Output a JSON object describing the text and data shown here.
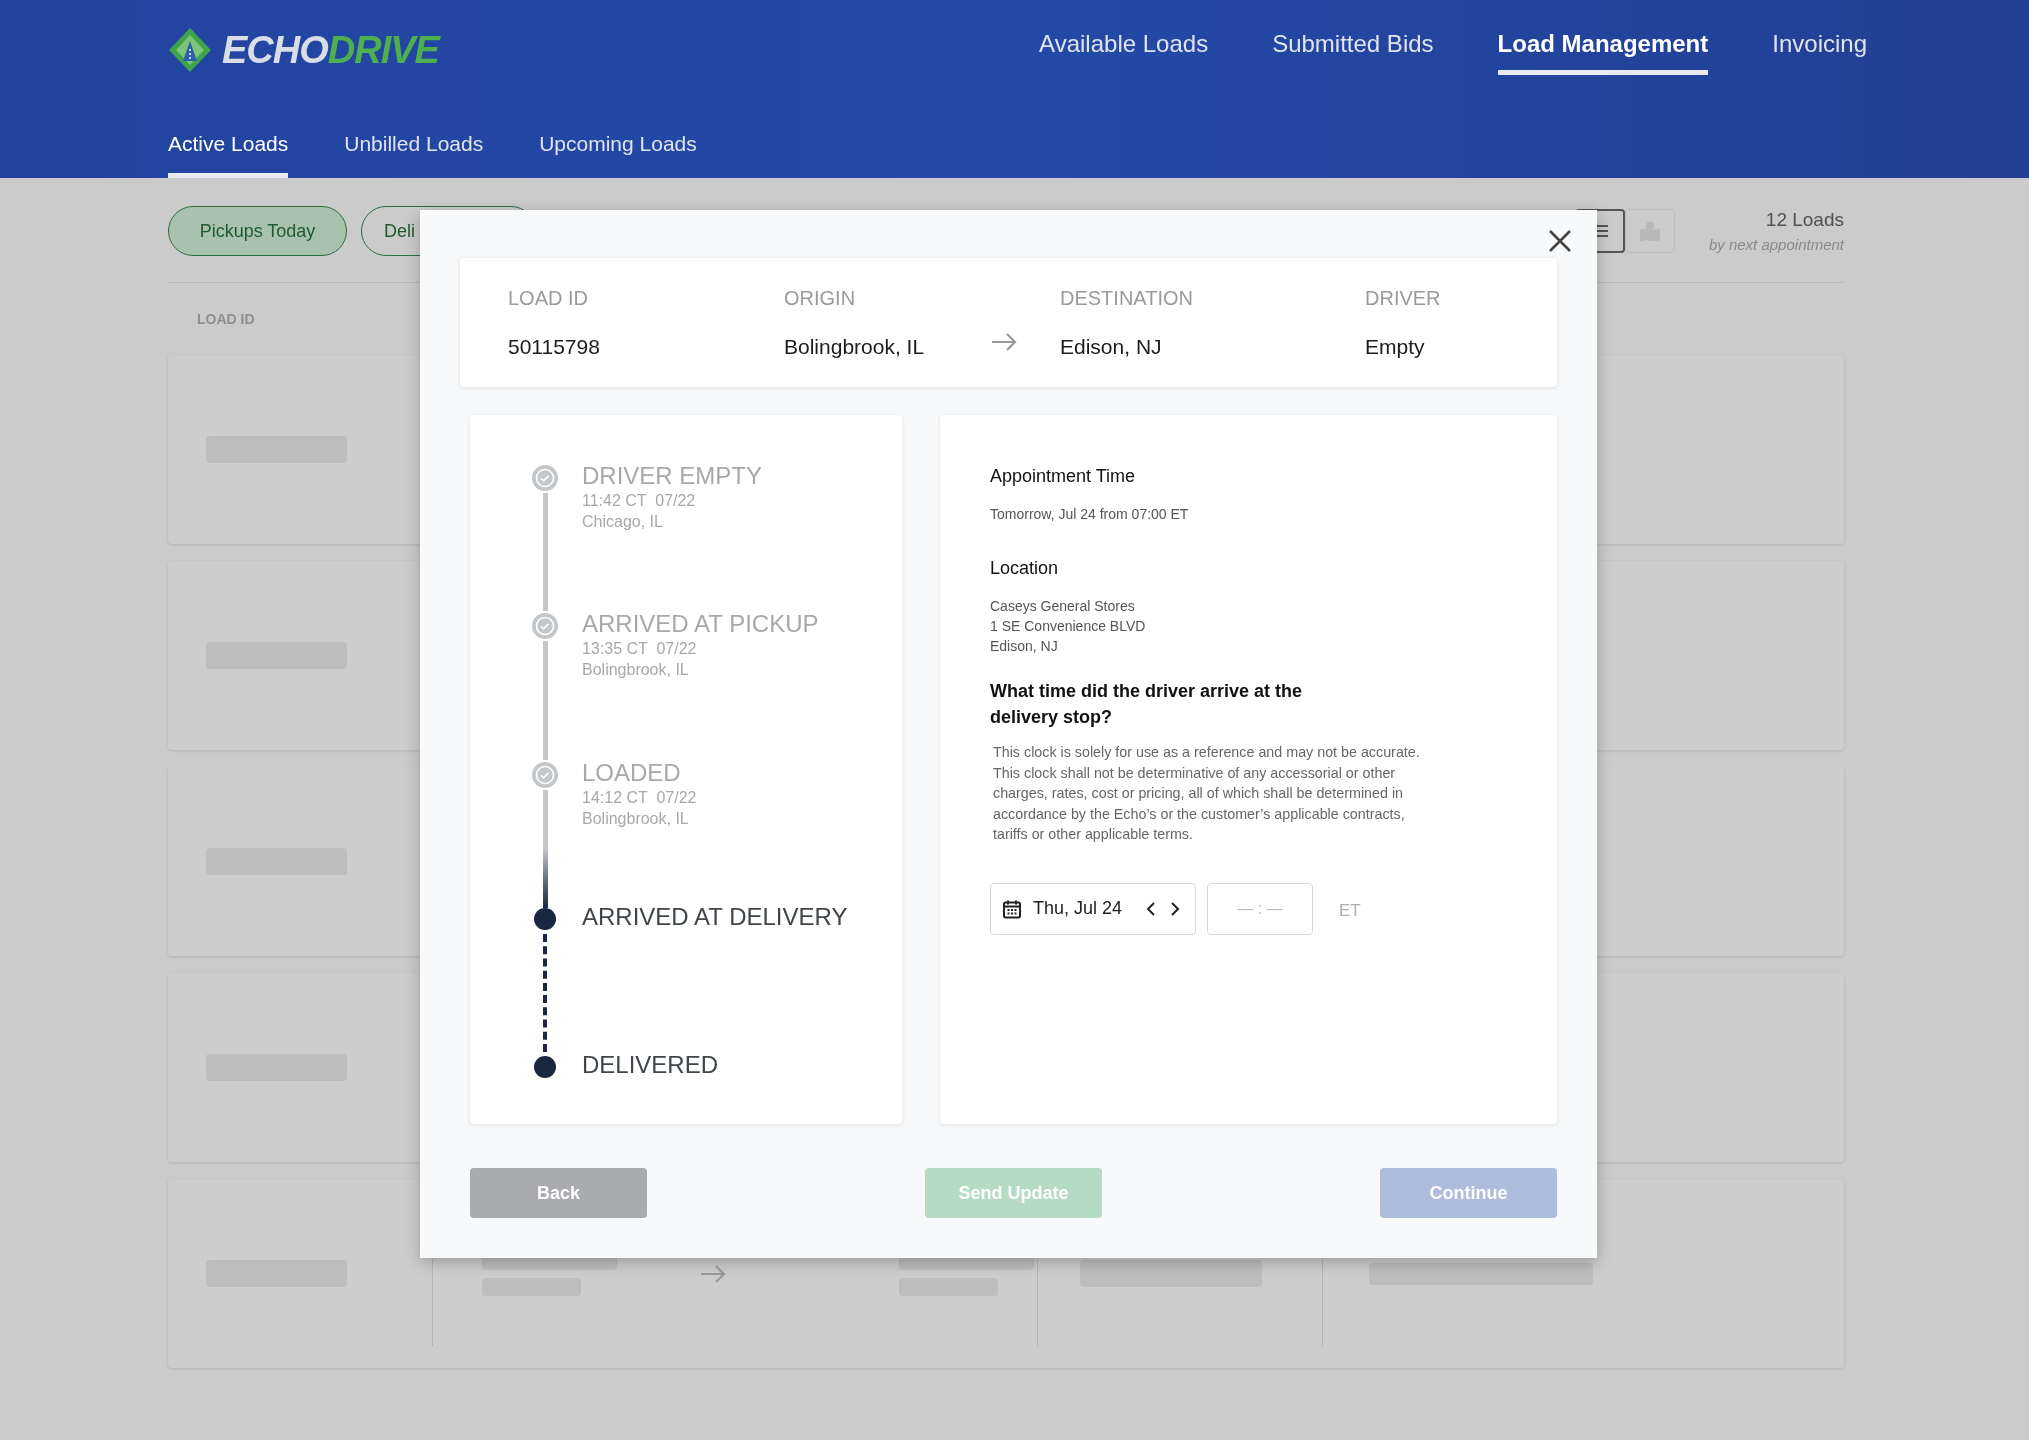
{
  "logo": {
    "word_1": "ECHO",
    "word_2": "DRIVE"
  },
  "nav": [
    {
      "label": "Available Loads",
      "selected": false
    },
    {
      "label": "Submitted Bids",
      "selected": false
    },
    {
      "label": "Load Management",
      "selected": true
    },
    {
      "label": "Invoicing",
      "selected": false
    }
  ],
  "subtabs": [
    {
      "label": "Active Loads",
      "selected": true
    },
    {
      "label": "Unbilled Loads",
      "selected": false
    },
    {
      "label": "Upcoming Loads",
      "selected": false
    }
  ],
  "filters": [
    {
      "label": "Pickups Today",
      "selected": true
    },
    {
      "label": "Deli",
      "selected": false
    }
  ],
  "view_toggle": [
    {
      "kind": "list",
      "selected": true
    },
    {
      "kind": "map",
      "selected": false
    }
  ],
  "load_count": {
    "count": "12 Loads",
    "sort": "by next appointment"
  },
  "table": {
    "column_1": "LOAD ID"
  },
  "modal": {
    "summary": [
      {
        "label": "LOAD ID",
        "value": "50115798"
      },
      {
        "label": "ORIGIN",
        "value": "Bolingbrook, IL"
      },
      {
        "label": "DESTINATION",
        "value": "Edison, NJ"
      },
      {
        "label": "DRIVER",
        "value": "Empty"
      }
    ],
    "timeline": [
      {
        "title": "DRIVER EMPTY",
        "completed": true,
        "time": "11:42 CT  07/22",
        "place": "Chicago, IL"
      },
      {
        "title": "ARRIVED AT PICKUP",
        "completed": true,
        "time": "13:35 CT  07/22",
        "place": "Bolingbrook, IL"
      },
      {
        "title": "LOADED",
        "completed": true,
        "time": "14:12 CT  07/22",
        "place": "Bolingbrook, IL"
      },
      {
        "title": "ARRIVED AT DELIVERY",
        "completed": false
      },
      {
        "title": "DELIVERED",
        "completed": false
      }
    ],
    "appointment": {
      "heading": "Appointment Time",
      "text": "Tomorrow, Jul 24 from 07:00 ET"
    },
    "location": {
      "heading": "Location",
      "lines": [
        "Caseys General Stores",
        "1 SE Convenience BLVD",
        "Edison, NJ"
      ]
    },
    "question": "What time did the driver arrive at the delivery stop?",
    "disclaimer": "This clock is solely for use as a reference and may not be accurate. This clock shall not be determinative of any accessorial or other charges, rates, cost or pricing, all of which shall be determined in accordance by the Echo’s or the customer’s applicable contracts, tariffs or other applicable terms.",
    "date": "Thu, Jul 24",
    "time_placeholder": "— : —",
    "timezone": "ET",
    "buttons": [
      {
        "label": "Back",
        "kind": "back",
        "disabled": true
      },
      {
        "label": "Send Update",
        "kind": "send",
        "disabled": true
      },
      {
        "label": "Continue",
        "kind": "continue",
        "disabled": true
      }
    ]
  }
}
